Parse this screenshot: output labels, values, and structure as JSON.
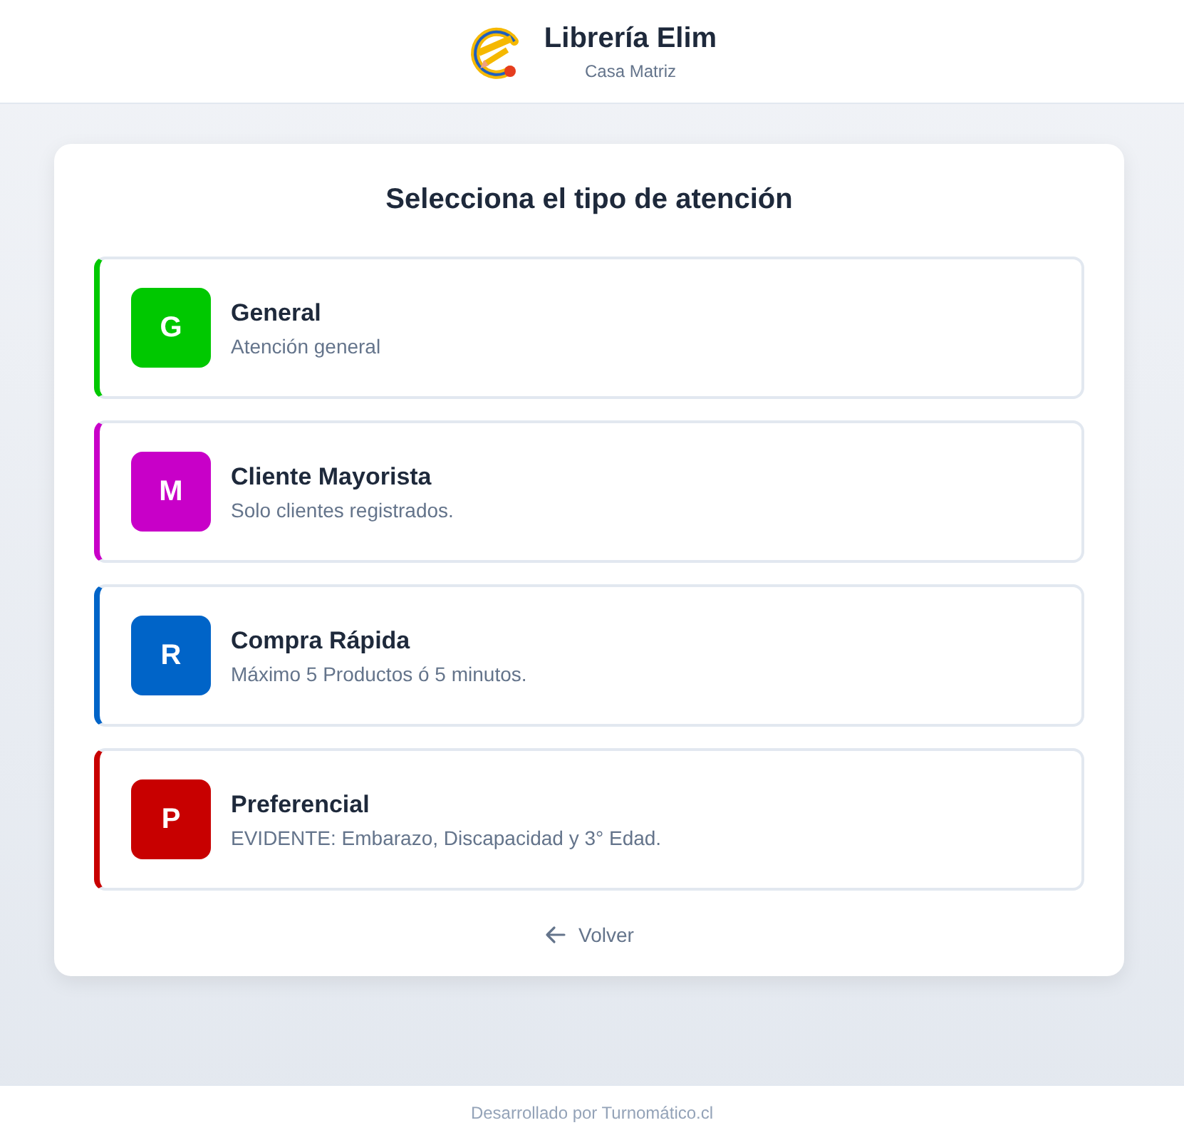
{
  "header": {
    "title": "Librería Elim",
    "subtitle": "Casa Matriz"
  },
  "card": {
    "title": "Selecciona el tipo de atención",
    "options": [
      {
        "letter": "G",
        "name": "General",
        "description": "Atención general",
        "color": "#00c800"
      },
      {
        "letter": "M",
        "name": "Cliente Mayorista",
        "description": "Solo clientes registrados.",
        "color": "#c800c8"
      },
      {
        "letter": "R",
        "name": "Compra Rápida",
        "description": "Máximo 5 Productos ó 5 minutos.",
        "color": "#0064c8"
      },
      {
        "letter": "P",
        "name": "Preferencial",
        "description": "EVIDENTE: Embarazo, Discapacidad y 3° Edad.",
        "color": "#c80000"
      }
    ],
    "back": "Volver"
  },
  "footer": "Desarrollado por Turnomático.cl"
}
